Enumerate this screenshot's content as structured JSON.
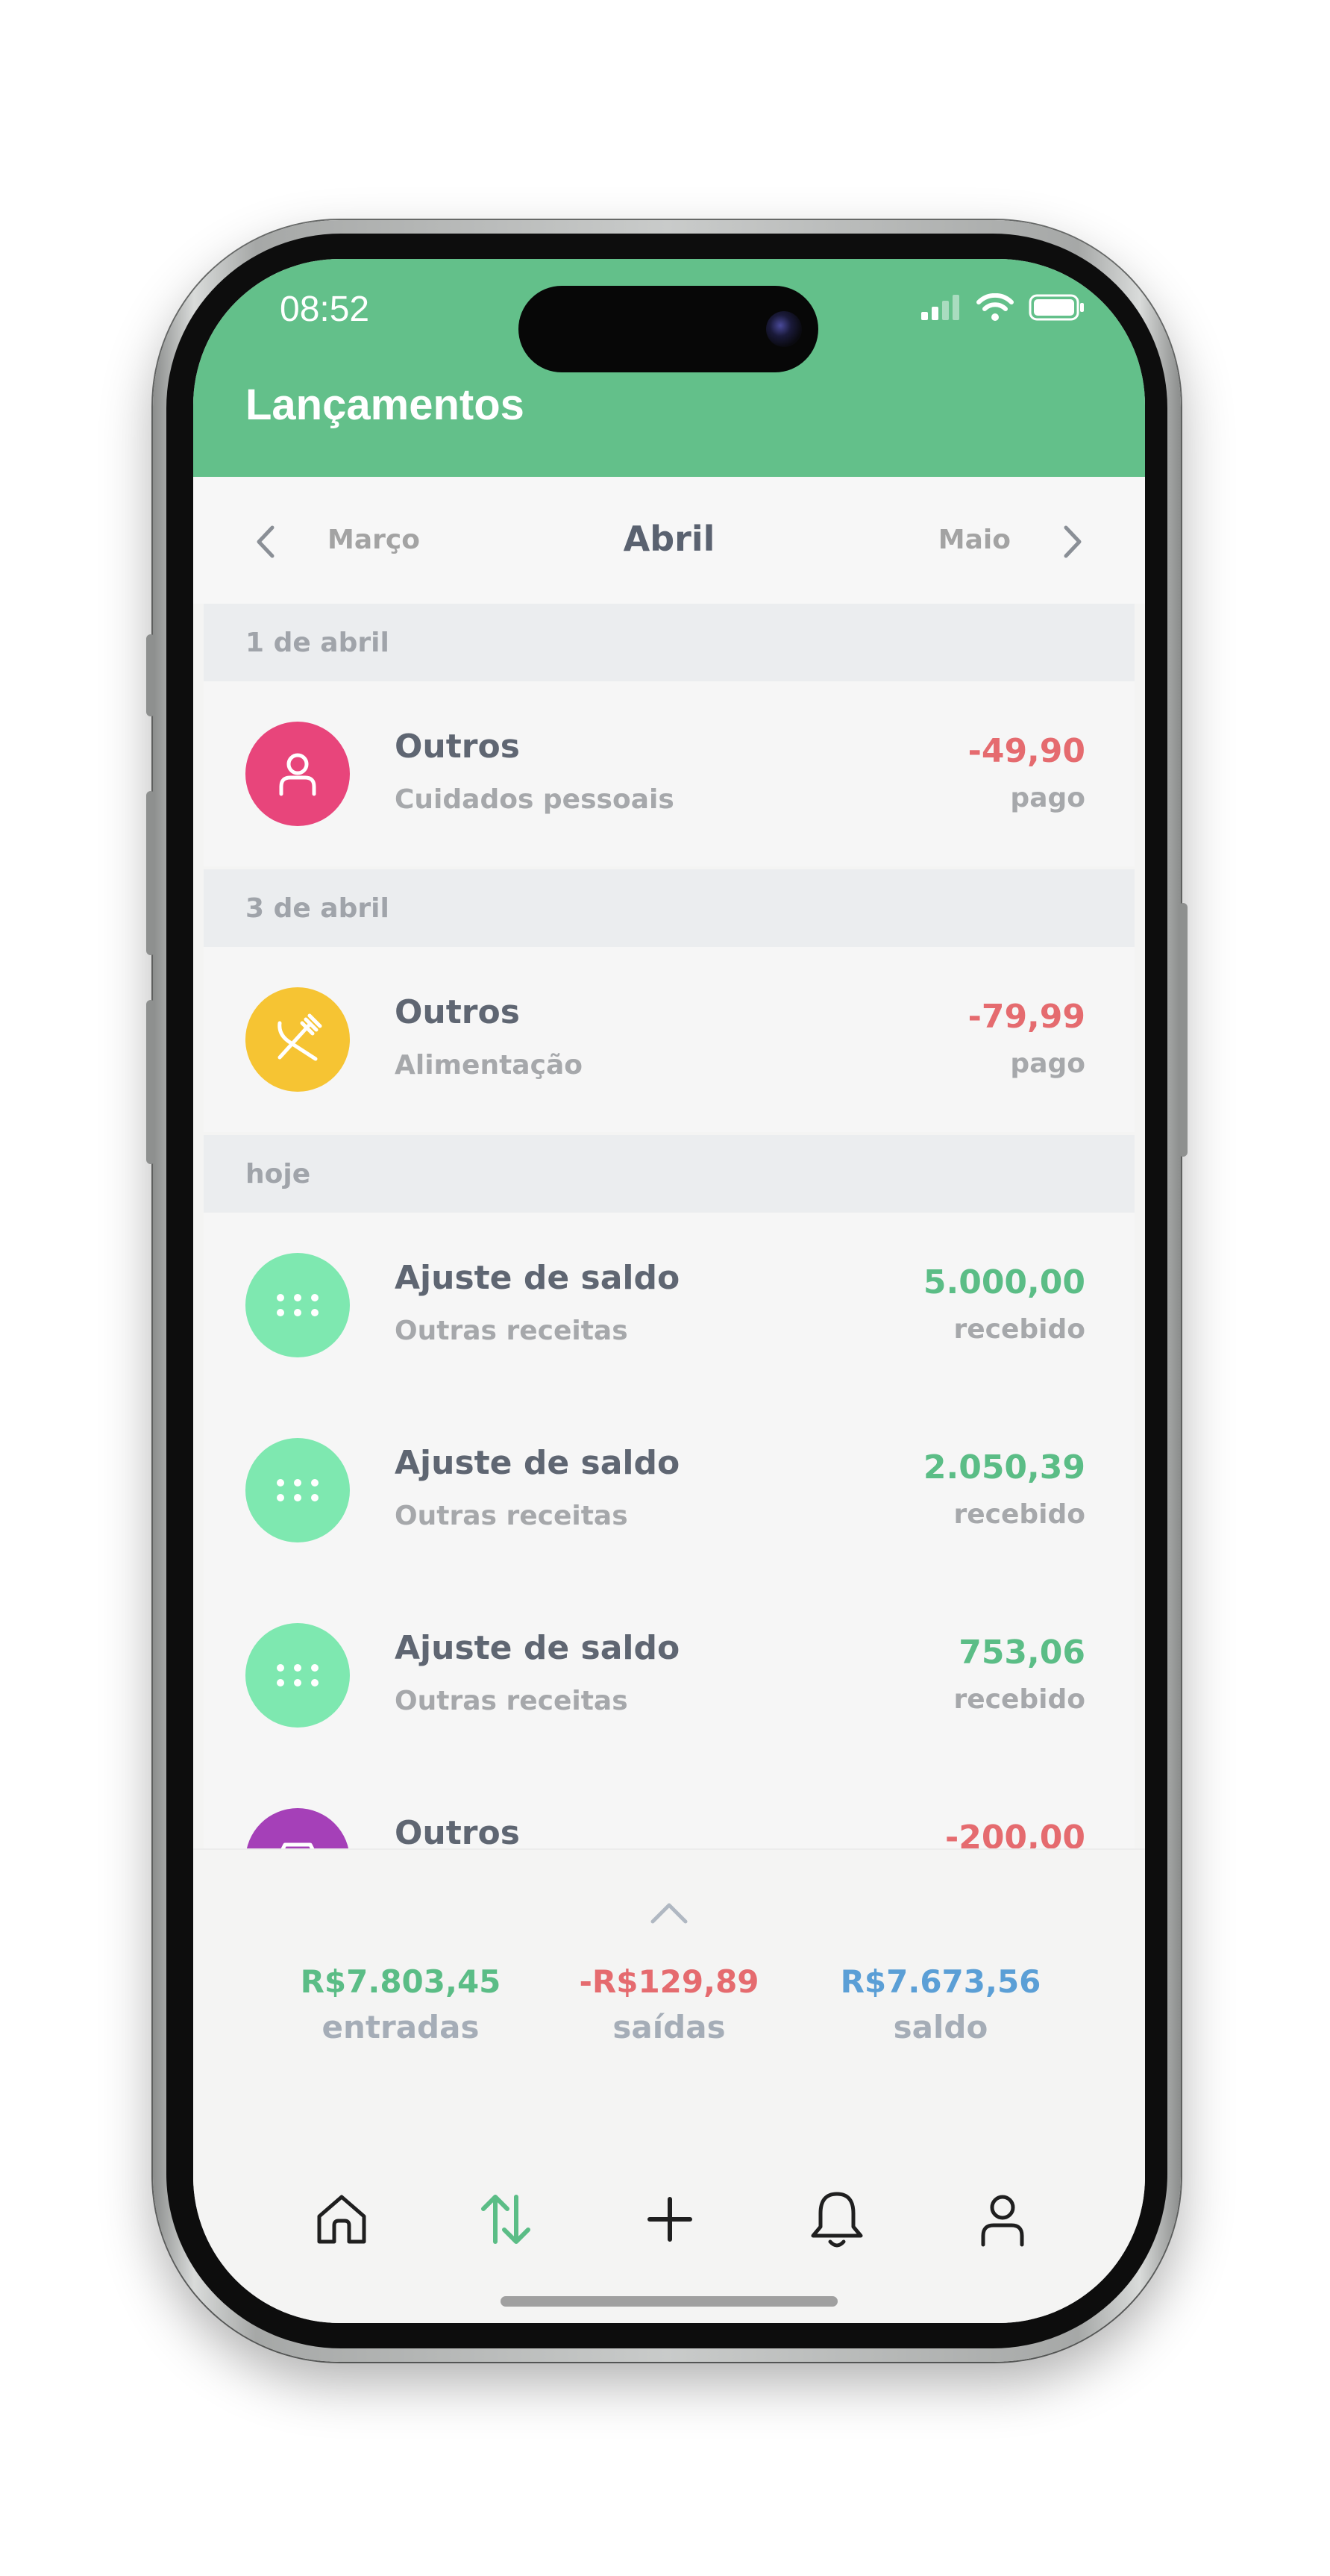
{
  "status_bar": {
    "time": "08:52"
  },
  "header": {
    "title": "Lançamentos"
  },
  "month_nav": {
    "prev": "Março",
    "current": "Abril",
    "next": "Maio"
  },
  "sections": [
    {
      "date": "1 de abril",
      "items": [
        {
          "title": "Outros",
          "category": "Cuidados pessoais",
          "amount": "-49,90",
          "status": "pago",
          "icon": "person-icon",
          "icon_color": "#e8457b",
          "amount_color": "#e56b6f"
        }
      ]
    },
    {
      "date": "3 de abril",
      "items": [
        {
          "title": "Outros",
          "category": "Alimentação",
          "amount": "-79,99",
          "status": "pago",
          "icon": "fork-knife-icon",
          "icon_color": "#f6c433",
          "amount_color": "#e56b6f"
        }
      ]
    },
    {
      "date": "hoje",
      "items": [
        {
          "title": "Ajuste de saldo",
          "category": "Outras receitas",
          "amount": "5.000,00",
          "status": "recebido",
          "icon": "dots-grid-icon",
          "icon_color": "#7ee8b0",
          "amount_color": "#5bbd86"
        },
        {
          "title": "Ajuste de saldo",
          "category": "Outras receitas",
          "amount": "2.050,39",
          "status": "recebido",
          "icon": "dots-grid-icon",
          "icon_color": "#7ee8b0",
          "amount_color": "#5bbd86"
        },
        {
          "title": "Ajuste de saldo",
          "category": "Outras receitas",
          "amount": "753,06",
          "status": "recebido",
          "icon": "dots-grid-icon",
          "icon_color": "#7ee8b0",
          "amount_color": "#5bbd86"
        },
        {
          "title": "Outros",
          "amount": "-200,00",
          "icon": "shop-icon",
          "icon_color": "#a540b8",
          "amount_color": "#e56b6f"
        }
      ]
    }
  ],
  "summary": {
    "income_value": "R$7.803,45",
    "income_label": "entradas",
    "income_color": "#5bbd86",
    "expense_value": "-R$129,89",
    "expense_label": "saídas",
    "expense_color": "#e56b6f",
    "balance_value": "R$7.673,56",
    "balance_label": "saldo",
    "balance_color": "#5b9fd6"
  },
  "tabbar": {
    "items": [
      {
        "icon": "home-icon"
      },
      {
        "icon": "transactions-icon",
        "active": true,
        "color": "#5bbd86"
      },
      {
        "icon": "plus-icon"
      },
      {
        "icon": "bell-icon"
      },
      {
        "icon": "profile-icon"
      }
    ]
  },
  "colors": {
    "header": "#63c08a",
    "accent_green": "#5bbd86",
    "negative_red": "#e56b6f",
    "balance_blue": "#5b9fd6"
  }
}
